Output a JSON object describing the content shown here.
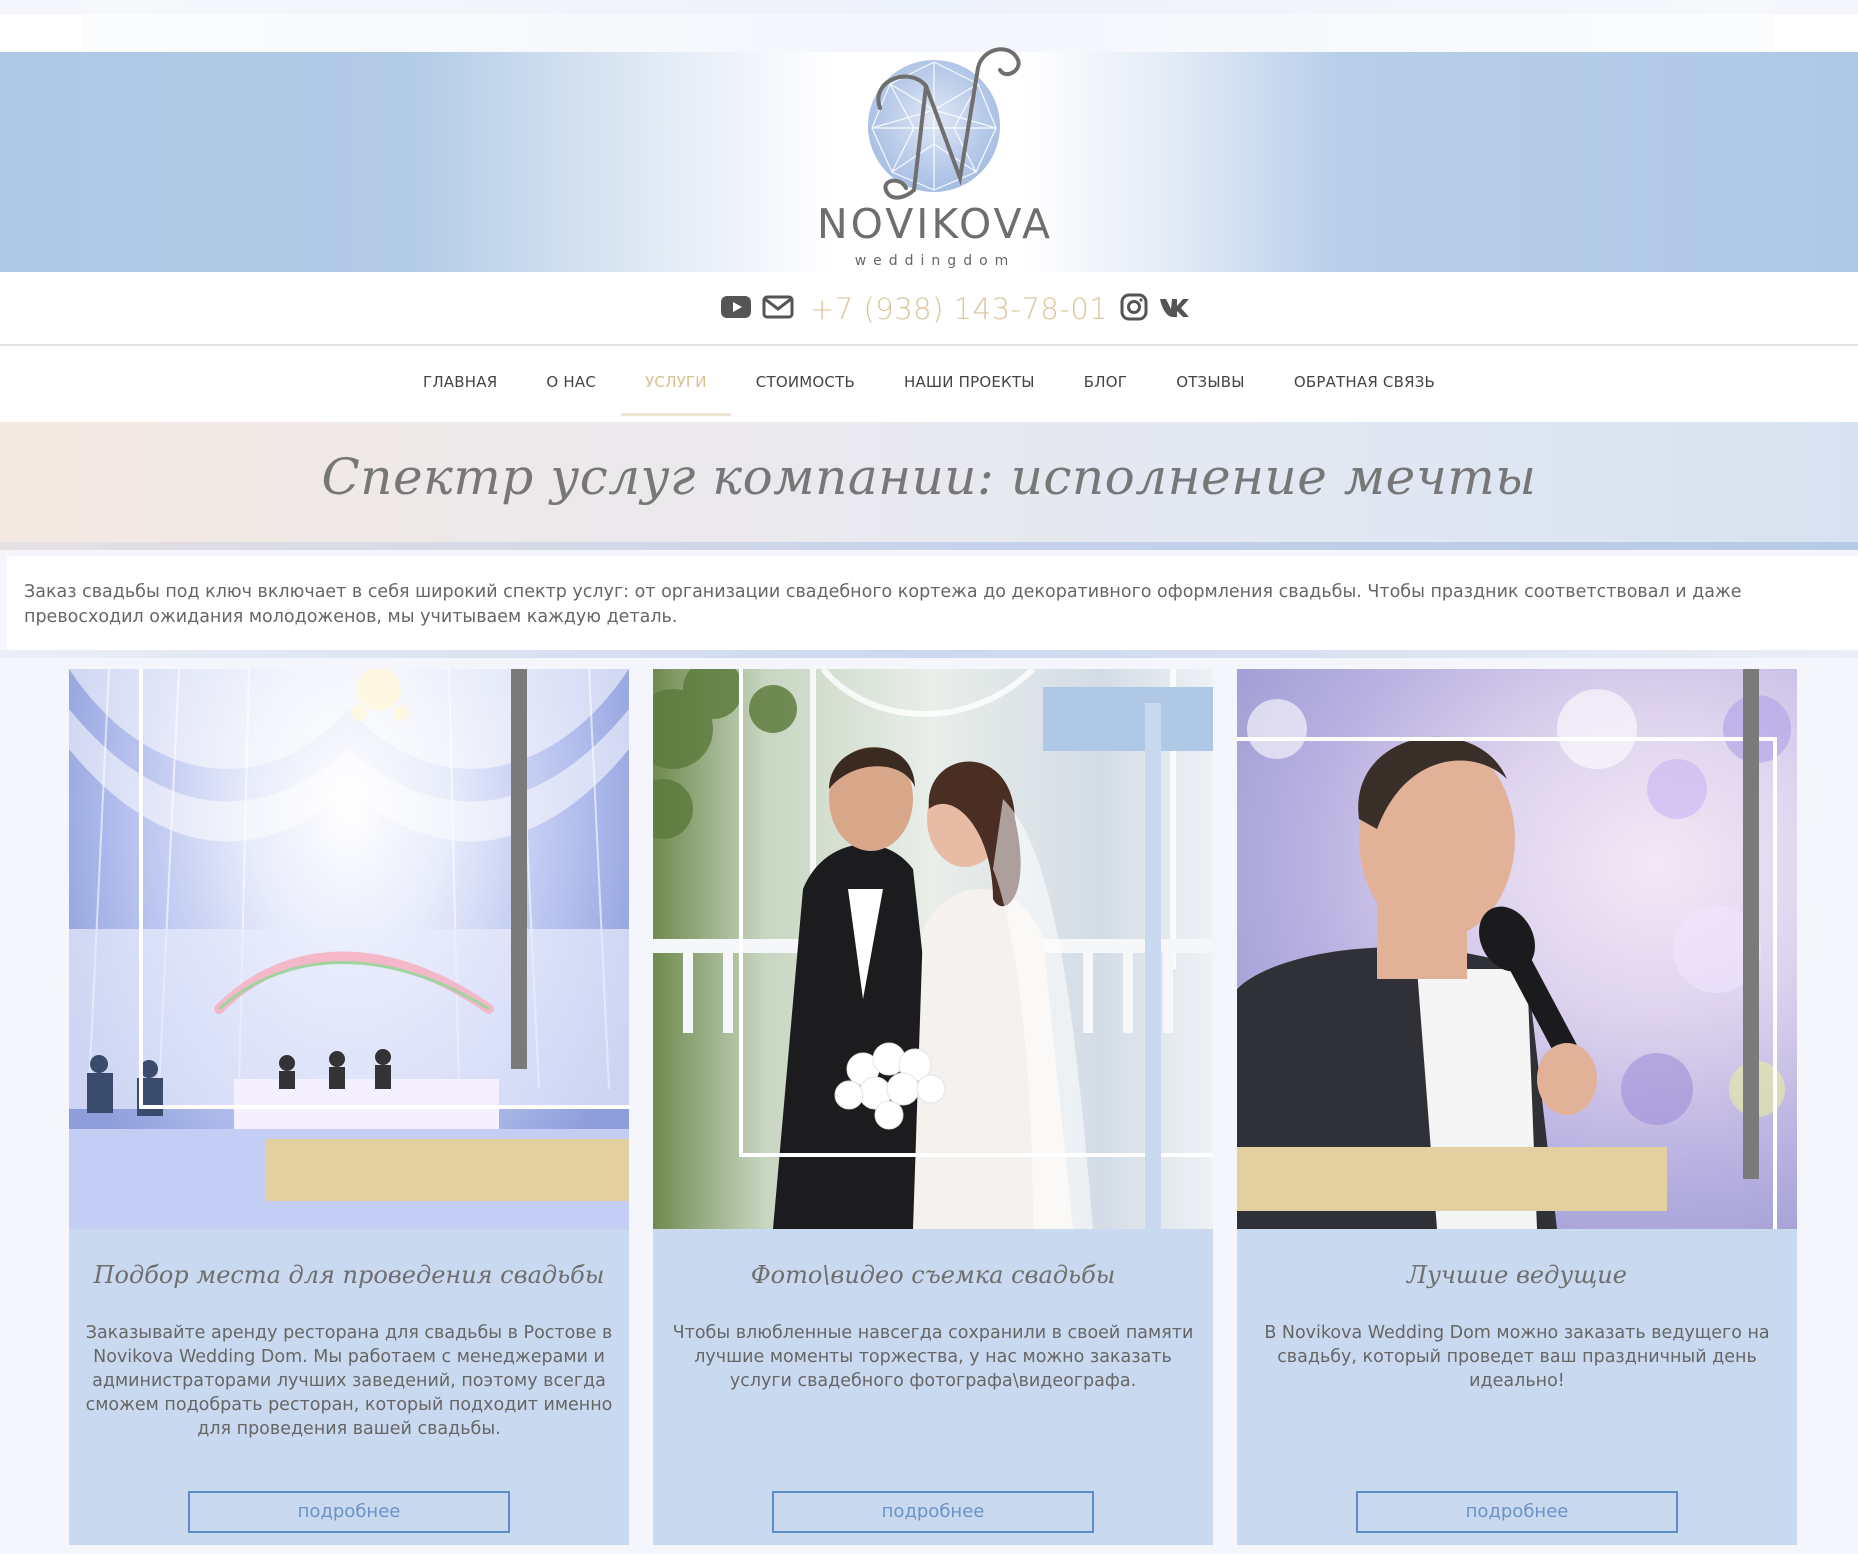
{
  "brand": {
    "name": "NOVIKOVA",
    "subtitle": "weddingdom",
    "colors": {
      "banner_blue": "#aec8e6",
      "gold": "#dcc59a",
      "card_blue": "#c9d9ef",
      "button_blue": "#5b8dc6"
    }
  },
  "contact": {
    "phone": "+7 (938) 143-78-01",
    "icons": [
      "youtube-icon",
      "mail-icon",
      "instagram-icon",
      "vk-icon"
    ]
  },
  "nav": {
    "items": [
      {
        "label": "ГЛАВНАЯ"
      },
      {
        "label": "О НАС"
      },
      {
        "label": "УСЛУГИ",
        "active": true
      },
      {
        "label": "СТОИМОСТЬ"
      },
      {
        "label": "НАШИ ПРОЕКТЫ"
      },
      {
        "label": "БЛОГ"
      },
      {
        "label": "ОТЗЫВЫ"
      },
      {
        "label": "ОБРАТНАЯ СВЯЗЬ"
      }
    ]
  },
  "hero": {
    "title": "Спектр услуг компании: исполнение мечты"
  },
  "intro": {
    "text": "Заказ свадьбы под ключ включает в себя широкий спектр услуг: от организации свадебного кортежа до декоративного оформления свадьбы. Чтобы праздник соответствовал и даже превосходил ожидания молодоженов, мы учитываем каждую деталь."
  },
  "cards": [
    {
      "title": "Подбор места для проведения свадьбы",
      "text": "Заказывайте аренду ресторана для свадьбы в Ростове в Novikova Wedding Dom. Мы работаем с менеджерами и администраторами лучших заведений, поэтому всегда сможем подобрать ресторан, который подходит именно для проведения вашей свадьбы.",
      "button": "подробнее"
    },
    {
      "title": "Фото\\видео съемка свадьбы",
      "text": "Чтобы влюбленные навсегда сохранили в своей памяти лучшие моменты торжества, у нас можно заказать услуги свадебного фотографа\\видеографа.",
      "button": "подробнее"
    },
    {
      "title": "Лучшие ведущие",
      "text": "В Novikova Wedding Dom можно заказать ведущего на свадьбу, который проведет ваш праздничный день идеально!",
      "button": "подробнее"
    }
  ]
}
